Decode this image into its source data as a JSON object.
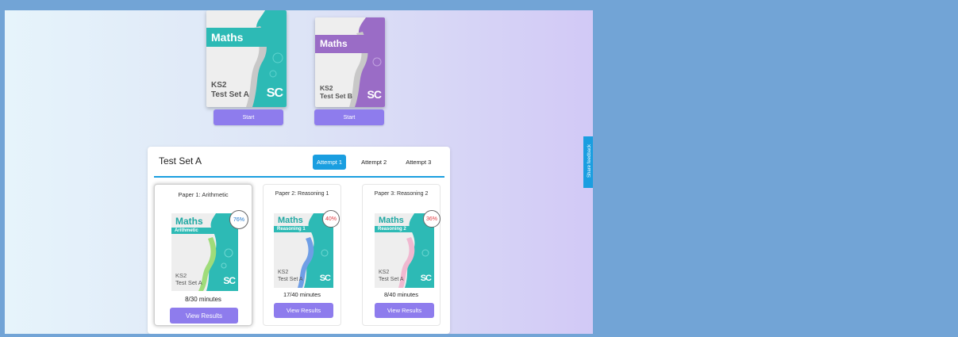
{
  "top_books": [
    {
      "subject": "Maths",
      "line1": "KS2",
      "line2": "Test Set A",
      "logo": "SC",
      "start_label": "Start",
      "color": "#2dbab5"
    },
    {
      "subject": "Maths",
      "line1": "KS2",
      "line2": "Test Set B",
      "logo": "SC",
      "start_label": "Start",
      "color": "#9a6cc6"
    }
  ],
  "card": {
    "title": "Test Set A",
    "tabs": [
      {
        "label": "Attempt 1",
        "active": true
      },
      {
        "label": "Attempt 2",
        "active": false
      },
      {
        "label": "Attempt 3",
        "active": false
      }
    ],
    "papers": [
      {
        "title": "Paper 1: Arithmetic",
        "subject": "Maths",
        "sub": "Arithmetic",
        "line1": "KS2",
        "line2": "Test Set A",
        "logo": "SC",
        "score": "76%",
        "score_color": "#1a73c9",
        "time": "8/30 minutes",
        "button": "View Results",
        "accent": "#9fdc7a"
      },
      {
        "title": "Paper 2: Reasoning 1",
        "subject": "Maths",
        "sub": "Reasoning 1",
        "line1": "KS2",
        "line2": "Test Set A",
        "logo": "SC",
        "score": "40%",
        "score_color": "#e0383e",
        "time": "17/40 minutes",
        "button": "View Results",
        "accent": "#6f9ee6"
      },
      {
        "title": "Paper 3: Reasoning 2",
        "subject": "Maths",
        "sub": "Reasoning 2",
        "line1": "KS2",
        "line2": "Test Set A",
        "logo": "SC",
        "score": "36%",
        "score_color": "#e0383e",
        "time": "8/40 minutes",
        "button": "View Results",
        "accent": "#f0b8d0"
      }
    ]
  },
  "feedback_label": "Share feedback",
  "colors": {
    "teal": "#2dbab5",
    "purple": "#9a6cc6",
    "button": "#8e7ced",
    "tab_active": "#1a9ee0"
  }
}
